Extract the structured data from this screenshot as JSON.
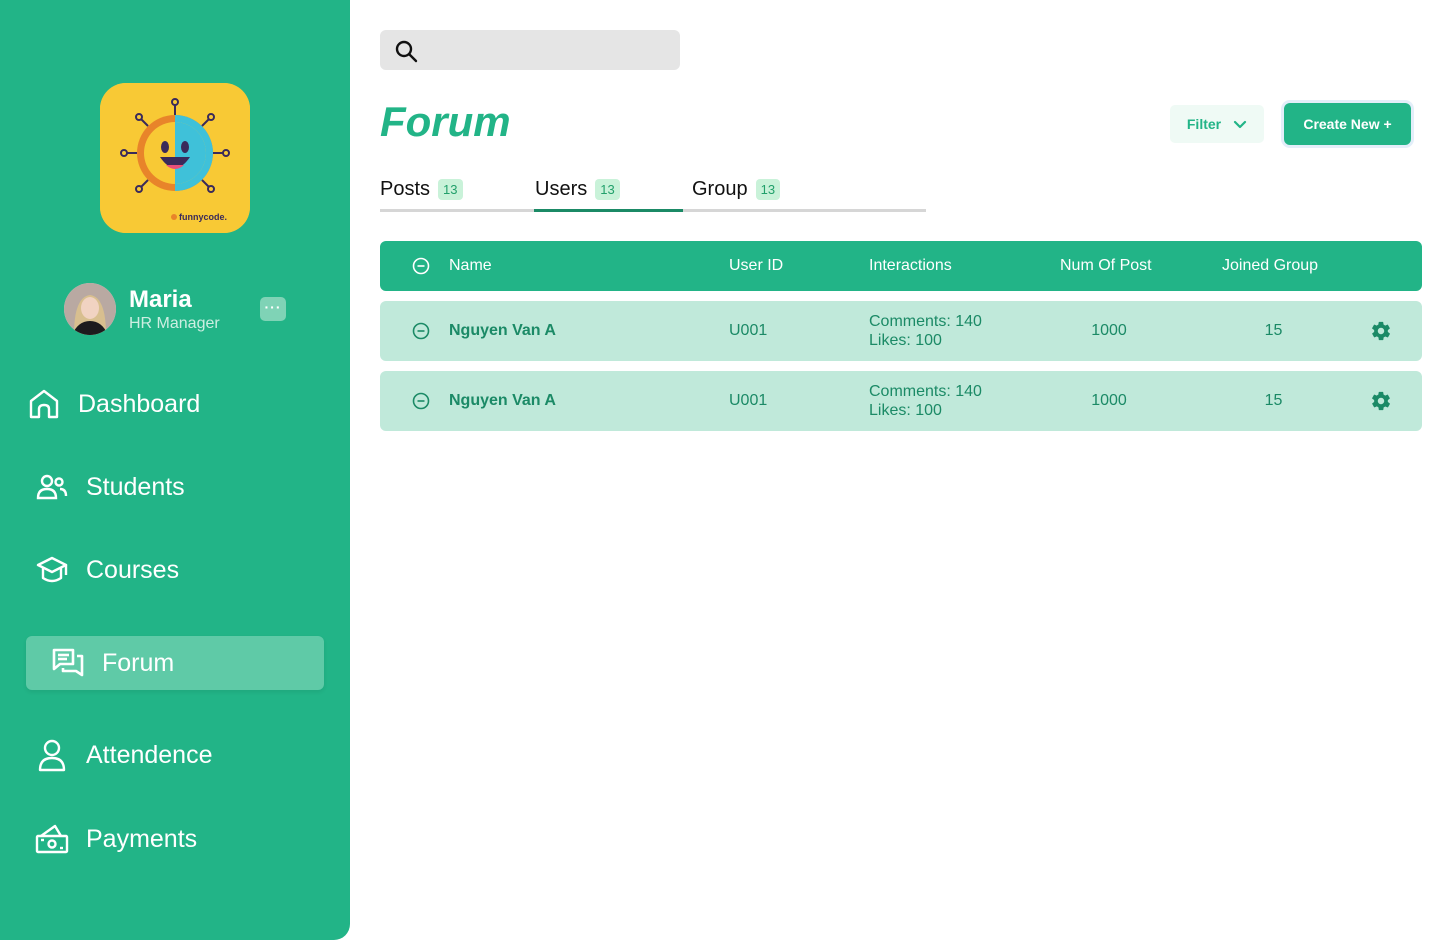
{
  "sidebar": {
    "user": {
      "name": "Maria",
      "role": "HR Manager",
      "more": "···"
    },
    "nav": [
      {
        "label": "Dashboard",
        "icon": "home-icon"
      },
      {
        "label": "Students",
        "icon": "students-icon"
      },
      {
        "label": "Courses",
        "icon": "graduation-cap-icon"
      },
      {
        "label": "Forum",
        "icon": "chat-bubbles-icon",
        "active": true
      },
      {
        "label": "Attendence",
        "icon": "person-icon"
      },
      {
        "label": "Payments",
        "icon": "money-icon"
      }
    ]
  },
  "search": {
    "placeholder": ""
  },
  "page": {
    "title": "Forum"
  },
  "actions": {
    "filter": "Filter",
    "create": "Create New +"
  },
  "tabs": [
    {
      "label": "Posts",
      "count": "13"
    },
    {
      "label": "Users",
      "count": "13",
      "active": true
    },
    {
      "label": "Group",
      "count": "13"
    }
  ],
  "table": {
    "headers": {
      "name": "Name",
      "user_id": "User ID",
      "interactions": "Interactions",
      "num_posts": "Num Of Post",
      "joined_group": "Joined Group"
    },
    "rows": [
      {
        "name": "Nguyen Van A",
        "user_id": "U001",
        "comments": "Comments: 140",
        "likes": "Likes: 100",
        "num_posts": "1000",
        "joined_group": "15"
      },
      {
        "name": "Nguyen Van A",
        "user_id": "U001",
        "comments": "Comments: 140",
        "likes": "Likes: 100",
        "num_posts": "1000",
        "joined_group": "15"
      }
    ]
  },
  "colors": {
    "brand": "#22b487",
    "row_bg": "#c0e9da",
    "row_text": "#1b8a66"
  }
}
